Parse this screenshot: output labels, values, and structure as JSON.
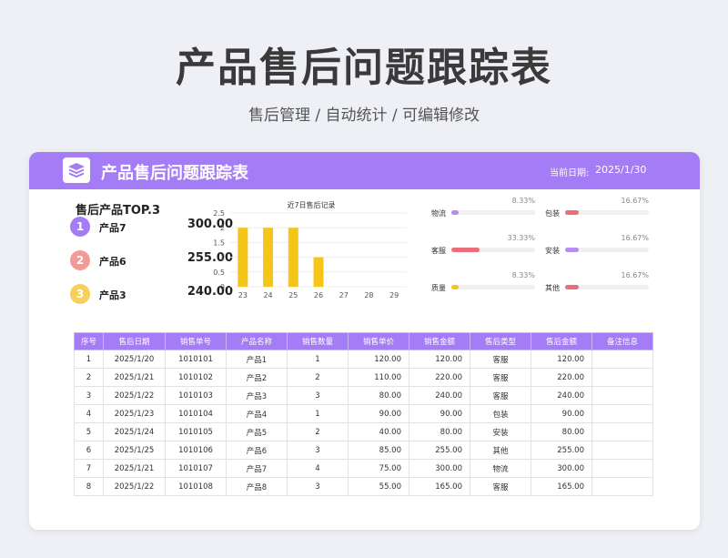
{
  "page": {
    "title": "产品售后问题跟踪表",
    "subtitle": "售后管理 /  自动统计  /  可编辑修改"
  },
  "card": {
    "title": "产品售后问题跟踪表",
    "date_label": "当前日期:",
    "date_value": "2025/1/30",
    "accent": "#a47cf6"
  },
  "top3": {
    "title": "售后产品TOP.3",
    "items": [
      {
        "rank": "1",
        "name": "产品7",
        "value": "300.00",
        "color": "#a47cf6"
      },
      {
        "rank": "2",
        "name": "产品6",
        "value": "255.00",
        "color": "#f29a96"
      },
      {
        "rank": "3",
        "name": "产品3",
        "value": "240.00",
        "color": "#f7d05a"
      }
    ]
  },
  "chart_data": {
    "type": "bar",
    "title": "近7日售后记录",
    "categories": [
      "23",
      "24",
      "25",
      "26",
      "27",
      "28",
      "29"
    ],
    "values": [
      2,
      2,
      2,
      1,
      0,
      0,
      0
    ],
    "ylim": [
      0,
      2.5
    ],
    "yticks": [
      "0",
      "0.5",
      "1",
      "1.5",
      "2",
      "2.5"
    ],
    "color": "#f5c518"
  },
  "categories": [
    {
      "name": "物流",
      "pct": "8.33%",
      "fraction": 0.0833,
      "color": "#b58ef0"
    },
    {
      "name": "包装",
      "pct": "16.67%",
      "fraction": 0.1667,
      "color": "#ea6e7a"
    },
    {
      "name": "客服",
      "pct": "33.33%",
      "fraction": 0.3333,
      "color": "#ea6e7a"
    },
    {
      "name": "安装",
      "pct": "16.67%",
      "fraction": 0.1667,
      "color": "#b58ef0"
    },
    {
      "name": "质量",
      "pct": "8.33%",
      "fraction": 0.0833,
      "color": "#f5c518"
    },
    {
      "name": "其他",
      "pct": "16.67%",
      "fraction": 0.1667,
      "color": "#ea6e7a"
    }
  ],
  "table": {
    "headers": [
      "序号",
      "售后日期",
      "销售单号",
      "产品名称",
      "销售数量",
      "销售单价",
      "销售金额",
      "售后类型",
      "售后金额",
      "备注信息"
    ],
    "rows": [
      [
        "1",
        "2025/1/20",
        "1010101",
        "产品1",
        "1",
        "120.00",
        "120.00",
        "客服",
        "120.00",
        ""
      ],
      [
        "2",
        "2025/1/21",
        "1010102",
        "产品2",
        "2",
        "110.00",
        "220.00",
        "客服",
        "220.00",
        ""
      ],
      [
        "3",
        "2025/1/22",
        "1010103",
        "产品3",
        "3",
        "80.00",
        "240.00",
        "客服",
        "240.00",
        ""
      ],
      [
        "4",
        "2025/1/23",
        "1010104",
        "产品4",
        "1",
        "90.00",
        "90.00",
        "包装",
        "90.00",
        ""
      ],
      [
        "5",
        "2025/1/24",
        "1010105",
        "产品5",
        "2",
        "40.00",
        "80.00",
        "安装",
        "80.00",
        ""
      ],
      [
        "6",
        "2025/1/25",
        "1010106",
        "产品6",
        "3",
        "85.00",
        "255.00",
        "其他",
        "255.00",
        ""
      ],
      [
        "7",
        "2025/1/21",
        "1010107",
        "产品7",
        "4",
        "75.00",
        "300.00",
        "物流",
        "300.00",
        ""
      ],
      [
        "8",
        "2025/1/22",
        "1010108",
        "产品8",
        "3",
        "55.00",
        "165.00",
        "客服",
        "165.00",
        ""
      ]
    ]
  }
}
